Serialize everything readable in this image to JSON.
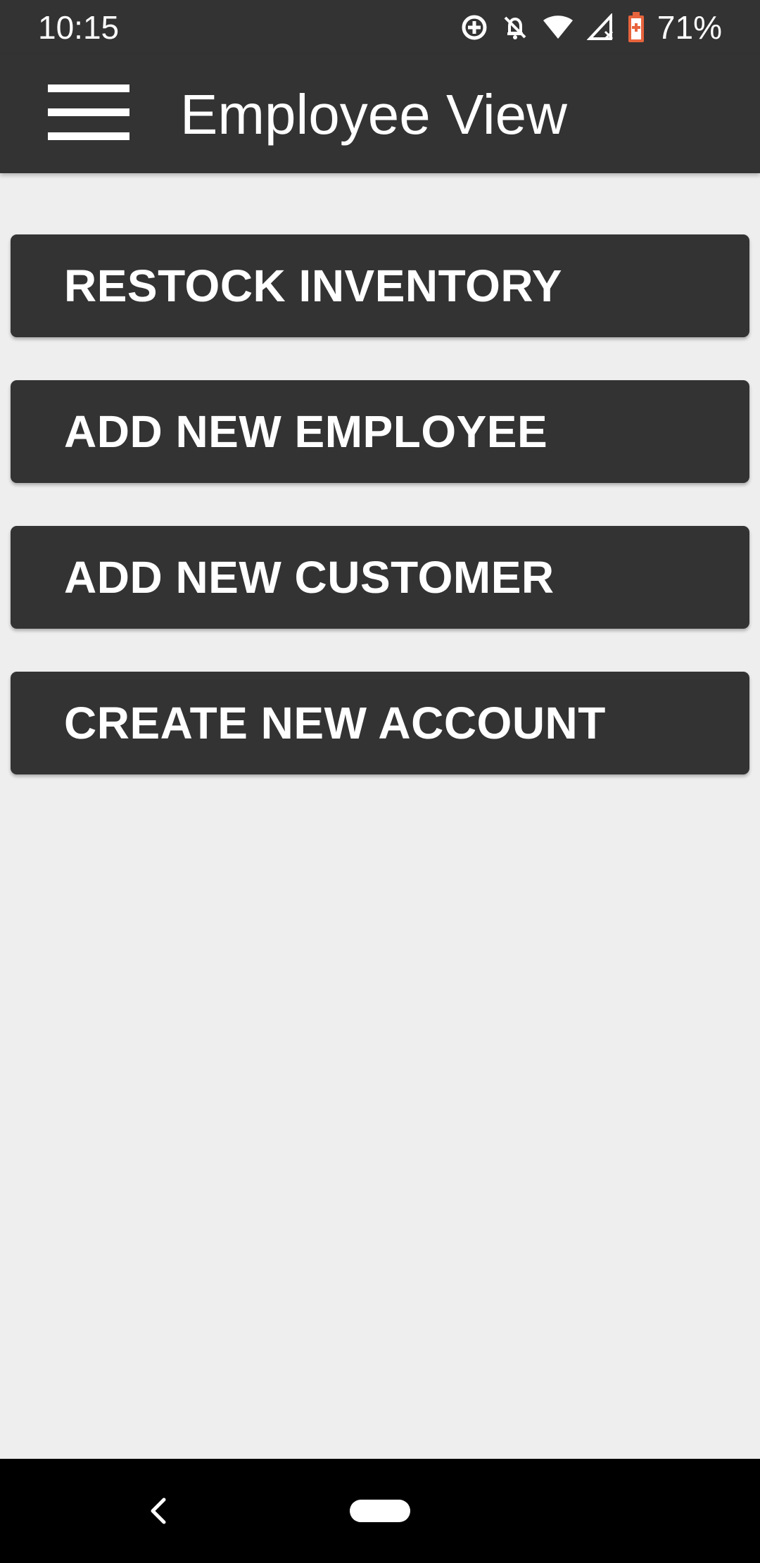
{
  "status_bar": {
    "time": "10:15",
    "battery_percent": "71%",
    "icons": [
      "data-saver-icon",
      "notifications-off-icon",
      "wifi-icon",
      "signal-icon",
      "battery-icon"
    ],
    "battery_color": "#e8643c"
  },
  "app_bar": {
    "title": "Employee View",
    "menu_icon": "hamburger-menu-icon",
    "background": "#333333"
  },
  "actions": [
    {
      "label": "RESTOCK INVENTORY"
    },
    {
      "label": "ADD NEW EMPLOYEE"
    },
    {
      "label": "ADD NEW CUSTOMER"
    },
    {
      "label": "CREATE NEW ACCOUNT"
    }
  ],
  "nav_bar": {
    "icons": [
      "back-icon",
      "home-pill-icon"
    ]
  },
  "colors": {
    "page_background": "#eeeeee",
    "button_background": "#333333",
    "button_text": "#ffffff"
  }
}
